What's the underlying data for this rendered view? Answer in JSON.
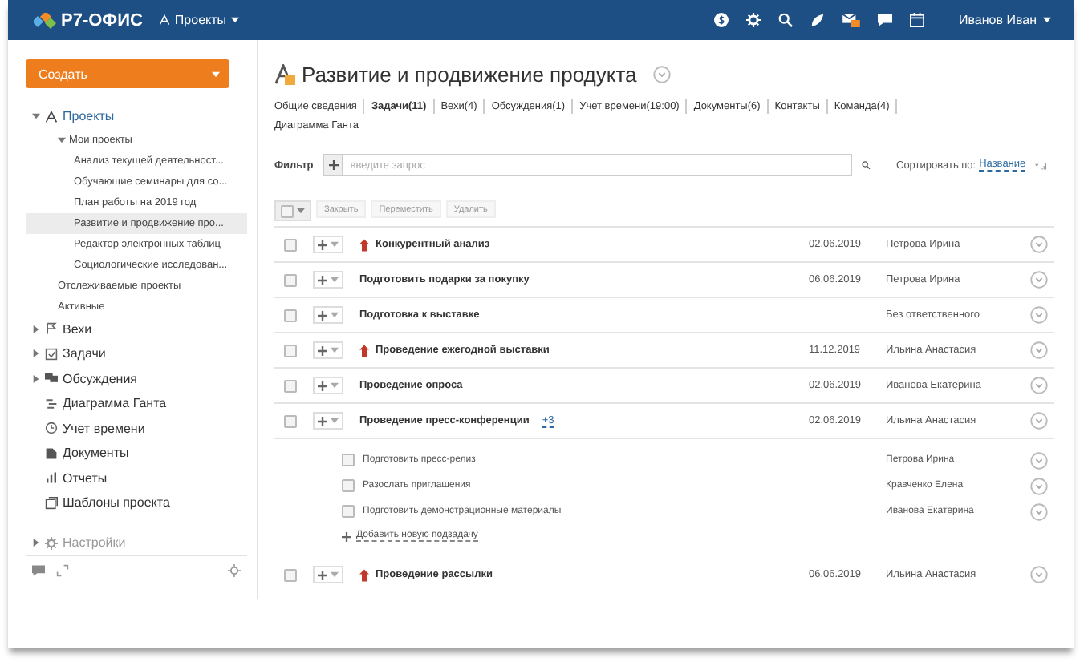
{
  "header": {
    "logo": "Р7-ОФИС",
    "module": "Проекты",
    "user": "Иванов Иван",
    "mail_badge": true
  },
  "sidebar": {
    "create_button": "Создать",
    "tree": [
      {
        "label": "Проекты",
        "kind": "projects",
        "expanded": true,
        "children": [
          {
            "label": "Мои проекты",
            "expanded": true,
            "children": [
              {
                "label": "Анализ текущей деятельност...",
                "selected": false
              },
              {
                "label": "Обучающие семинары для со...",
                "selected": false
              },
              {
                "label": "План работы на 2019 год",
                "selected": false
              },
              {
                "label": "Развитие и продвижение про...",
                "selected": true
              },
              {
                "label": "Редактор электронных таблиц",
                "selected": false
              },
              {
                "label": "Социологические исследован...",
                "selected": false
              }
            ]
          },
          {
            "label": "Отслеживаемые проекты"
          },
          {
            "label": "Активные"
          }
        ]
      },
      {
        "label": "Вехи",
        "kind": "flag",
        "expanded": false
      },
      {
        "label": "Задачи",
        "kind": "task",
        "expanded": false
      },
      {
        "label": "Обсуждения",
        "kind": "chat",
        "expanded": false
      },
      {
        "label": "Диаграмма Ганта",
        "kind": "gantt"
      },
      {
        "label": "Учет времени",
        "kind": "clock"
      },
      {
        "label": "Документы",
        "kind": "doc"
      },
      {
        "label": "Отчеты",
        "kind": "chart"
      },
      {
        "label": "Шаблоны проекта",
        "kind": "template"
      }
    ],
    "settings": "Настройки"
  },
  "project": {
    "title": "Развитие и продвижение продукта"
  },
  "tabs": [
    {
      "label": "Общие сведения",
      "selected": false
    },
    {
      "label": "Задачи(11)",
      "selected": true
    },
    {
      "label": "Вехи(4)",
      "selected": false
    },
    {
      "label": "Обсуждения(1)",
      "selected": false
    },
    {
      "label": "Учет времени(19:00)",
      "selected": false
    },
    {
      "label": "Документы(6)",
      "selected": false
    },
    {
      "label": "Контакты",
      "selected": false
    },
    {
      "label": "Команда(4)",
      "selected": false
    },
    {
      "label": "Диаграмма Ганта",
      "selected": false
    }
  ],
  "filter": {
    "label": "Фильтр",
    "placeholder": "введите запрос",
    "sort_label": "Сортировать по:",
    "sort_value": "Название"
  },
  "select_all": {
    "checked": false
  },
  "actions": [
    "Закрыть",
    "Переместить",
    "Удалить"
  ],
  "tasks": [
    {
      "title": "Конкурентный анализ",
      "checked": false,
      "important": true,
      "date": "02.06.2019",
      "responsible": "Петрова Ирина"
    },
    {
      "title": "Подготовить подарки за покупку",
      "checked": false,
      "important": false,
      "date": "06.06.2019",
      "responsible": "Петрова Ирина"
    },
    {
      "title": "Подготовка к выставке",
      "checked": false,
      "important": false,
      "responsible": "Без ответственного"
    },
    {
      "title": "Проведение ежегодной выставки",
      "checked": false,
      "important": true,
      "date": "11.12.2019",
      "responsible": "Ильина Анастасия"
    },
    {
      "title": "Проведение опроса",
      "checked": false,
      "important": false,
      "date": "02.06.2019",
      "responsible": "Иванова Екатерина"
    },
    {
      "title": "Проведение пресс-конференции",
      "checked": false,
      "important": false,
      "subtask_count": "+3",
      "date": "02.06.2019",
      "responsible": "Ильина Анастасия",
      "subtasks": [
        {
          "title": "Подготовить пресс-релиз",
          "checked": false,
          "responsible": "Петрова Ирина"
        },
        {
          "title": "Разослать приглашения",
          "checked": false,
          "responsible": "Кравченко Елена"
        },
        {
          "title": "Подготовить демонстрационные материалы",
          "checked": false,
          "responsible": "Иванова Екатерина"
        }
      ],
      "add_subtask": "Добавить новую подзадачу"
    },
    {
      "title": "Проведение рассылки",
      "checked": false,
      "important": true,
      "date": "06.06.2019",
      "responsible": "Ильина Анастасия"
    }
  ]
}
